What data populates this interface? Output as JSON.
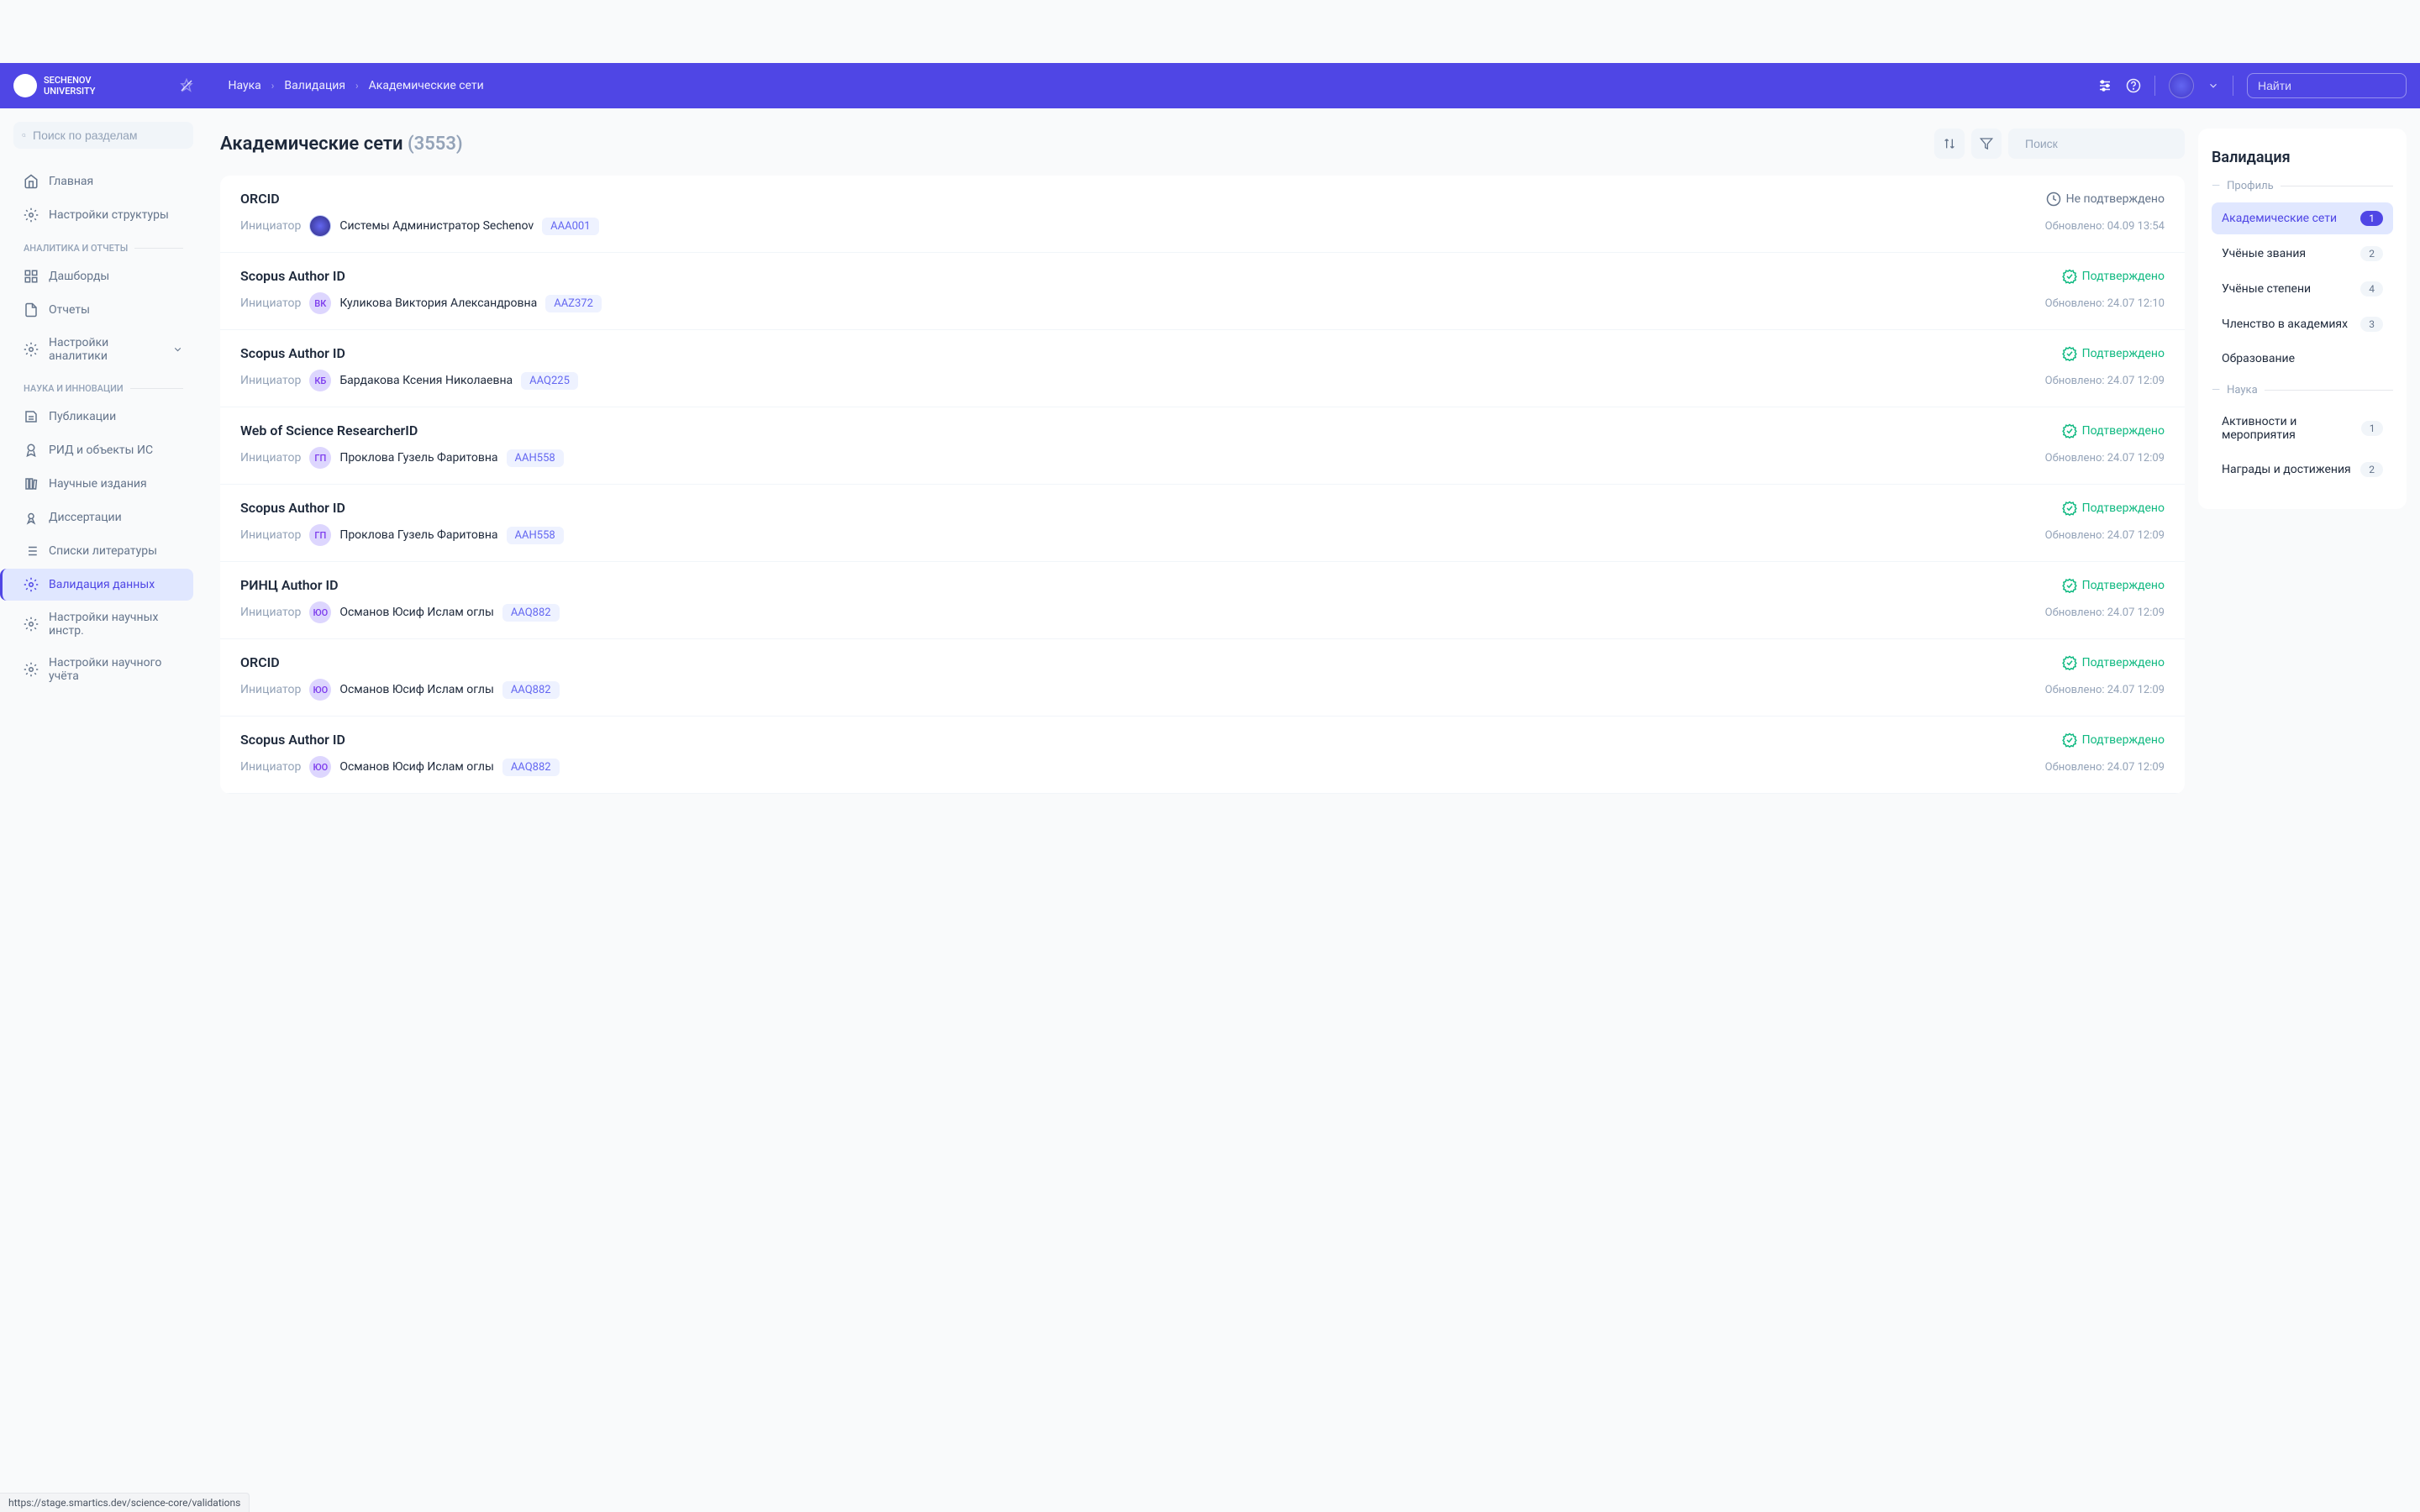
{
  "header": {
    "logo_text": "SECHENOV\nUNIVERSITY",
    "breadcrumb": [
      "Наука",
      "Валидация",
      "Академические сети"
    ],
    "search_placeholder": "Найти"
  },
  "sidebar": {
    "search_placeholder": "Поиск по разделам",
    "items": [
      {
        "label": "Главная",
        "icon": "home"
      },
      {
        "label": "Настройки структуры",
        "icon": "gear"
      }
    ],
    "section_analytics": "АНАЛИТИКА И ОТЧЕТЫ",
    "items_analytics": [
      {
        "label": "Дашборды",
        "icon": "dashboard"
      },
      {
        "label": "Отчеты",
        "icon": "report"
      },
      {
        "label": "Настройки аналитики",
        "icon": "gear",
        "expand": true
      }
    ],
    "section_science": "НАУКА И ИННОВАЦИИ",
    "items_science": [
      {
        "label": "Публикации",
        "icon": "doc"
      },
      {
        "label": "РИД и объекты ИС",
        "icon": "badge"
      },
      {
        "label": "Научные издания",
        "icon": "library"
      },
      {
        "label": "Диссертации",
        "icon": "diploma"
      },
      {
        "label": "Списки литературы",
        "icon": "list"
      },
      {
        "label": "Валидация данных",
        "icon": "gear",
        "active": true
      },
      {
        "label": "Настройки научных инстр.",
        "icon": "gear"
      },
      {
        "label": "Настройки научного учёта",
        "icon": "gear"
      }
    ]
  },
  "page": {
    "title": "Академические сети",
    "count": "(3553)",
    "search_placeholder": "Поиск"
  },
  "records": [
    {
      "title": "ORCID",
      "status": "pending",
      "status_text": "Не подтверждено",
      "initiator_label": "Инициатор",
      "avatar_type": "logo",
      "initials": "",
      "name": "Системы Администратор Sechenov",
      "code": "AAA001",
      "updated": "Обновлено: 04.09 13:54"
    },
    {
      "title": "Scopus Author ID",
      "status": "confirmed",
      "status_text": "Подтверждено",
      "initiator_label": "Инициатор",
      "avatar_type": "text",
      "initials": "ВК",
      "avatar_bg": "#ddd6fe",
      "avatar_fg": "#7c3aed",
      "name": "Куликова Виктория Александровна",
      "code": "AAZ372",
      "updated": "Обновлено: 24.07 12:10"
    },
    {
      "title": "Scopus Author ID",
      "status": "confirmed",
      "status_text": "Подтверждено",
      "initiator_label": "Инициатор",
      "avatar_type": "text",
      "initials": "КБ",
      "avatar_bg": "#ddd6fe",
      "avatar_fg": "#7c3aed",
      "name": "Бардакова Ксения Николаевна",
      "code": "AAQ225",
      "updated": "Обновлено: 24.07 12:09"
    },
    {
      "title": "Web of Science ResearcherID",
      "status": "confirmed",
      "status_text": "Подтверждено",
      "initiator_label": "Инициатор",
      "avatar_type": "text",
      "initials": "ГП",
      "avatar_bg": "#ddd6fe",
      "avatar_fg": "#7c3aed",
      "name": "Проклова Гузель Фаритовна",
      "code": "AAH558",
      "updated": "Обновлено: 24.07 12:09"
    },
    {
      "title": "Scopus Author ID",
      "status": "confirmed",
      "status_text": "Подтверждено",
      "initiator_label": "Инициатор",
      "avatar_type": "text",
      "initials": "ГП",
      "avatar_bg": "#ddd6fe",
      "avatar_fg": "#7c3aed",
      "name": "Проклова Гузель Фаритовна",
      "code": "AAH558",
      "updated": "Обновлено: 24.07 12:09"
    },
    {
      "title": "РИНЦ Author ID",
      "status": "confirmed",
      "status_text": "Подтверждено",
      "initiator_label": "Инициатор",
      "avatar_type": "text",
      "initials": "ЮО",
      "avatar_bg": "#ddd6fe",
      "avatar_fg": "#7c3aed",
      "name": "Османов Юсиф Ислам оглы",
      "code": "AAQ882",
      "updated": "Обновлено: 24.07 12:09"
    },
    {
      "title": "ORCID",
      "status": "confirmed",
      "status_text": "Подтверждено",
      "initiator_label": "Инициатор",
      "avatar_type": "text",
      "initials": "ЮО",
      "avatar_bg": "#ddd6fe",
      "avatar_fg": "#7c3aed",
      "name": "Османов Юсиф Ислам оглы",
      "code": "AAQ882",
      "updated": "Обновлено: 24.07 12:09"
    },
    {
      "title": "Scopus Author ID",
      "status": "confirmed",
      "status_text": "Подтверждено",
      "initiator_label": "Инициатор",
      "avatar_type": "text",
      "initials": "ЮО",
      "avatar_bg": "#ddd6fe",
      "avatar_fg": "#7c3aed",
      "name": "Османов Юсиф Ислам оглы",
      "code": "AAQ882",
      "updated": "Обновлено: 24.07 12:09"
    }
  ],
  "right": {
    "title": "Валидация",
    "section_profile": "Профиль",
    "items_profile": [
      {
        "label": "Академические сети",
        "badge": "1",
        "active": true
      },
      {
        "label": "Учёные звания",
        "badge": "2"
      },
      {
        "label": "Учёные степени",
        "badge": "4"
      },
      {
        "label": "Членство в академиях",
        "badge": "3"
      },
      {
        "label": "Образование"
      }
    ],
    "section_science": "Наука",
    "items_science": [
      {
        "label": "Активности и мероприятия",
        "badge": "1"
      },
      {
        "label": "Награды и достижения",
        "badge": "2"
      }
    ]
  },
  "status_url": "https://stage.smartics.dev/science-core/validations"
}
